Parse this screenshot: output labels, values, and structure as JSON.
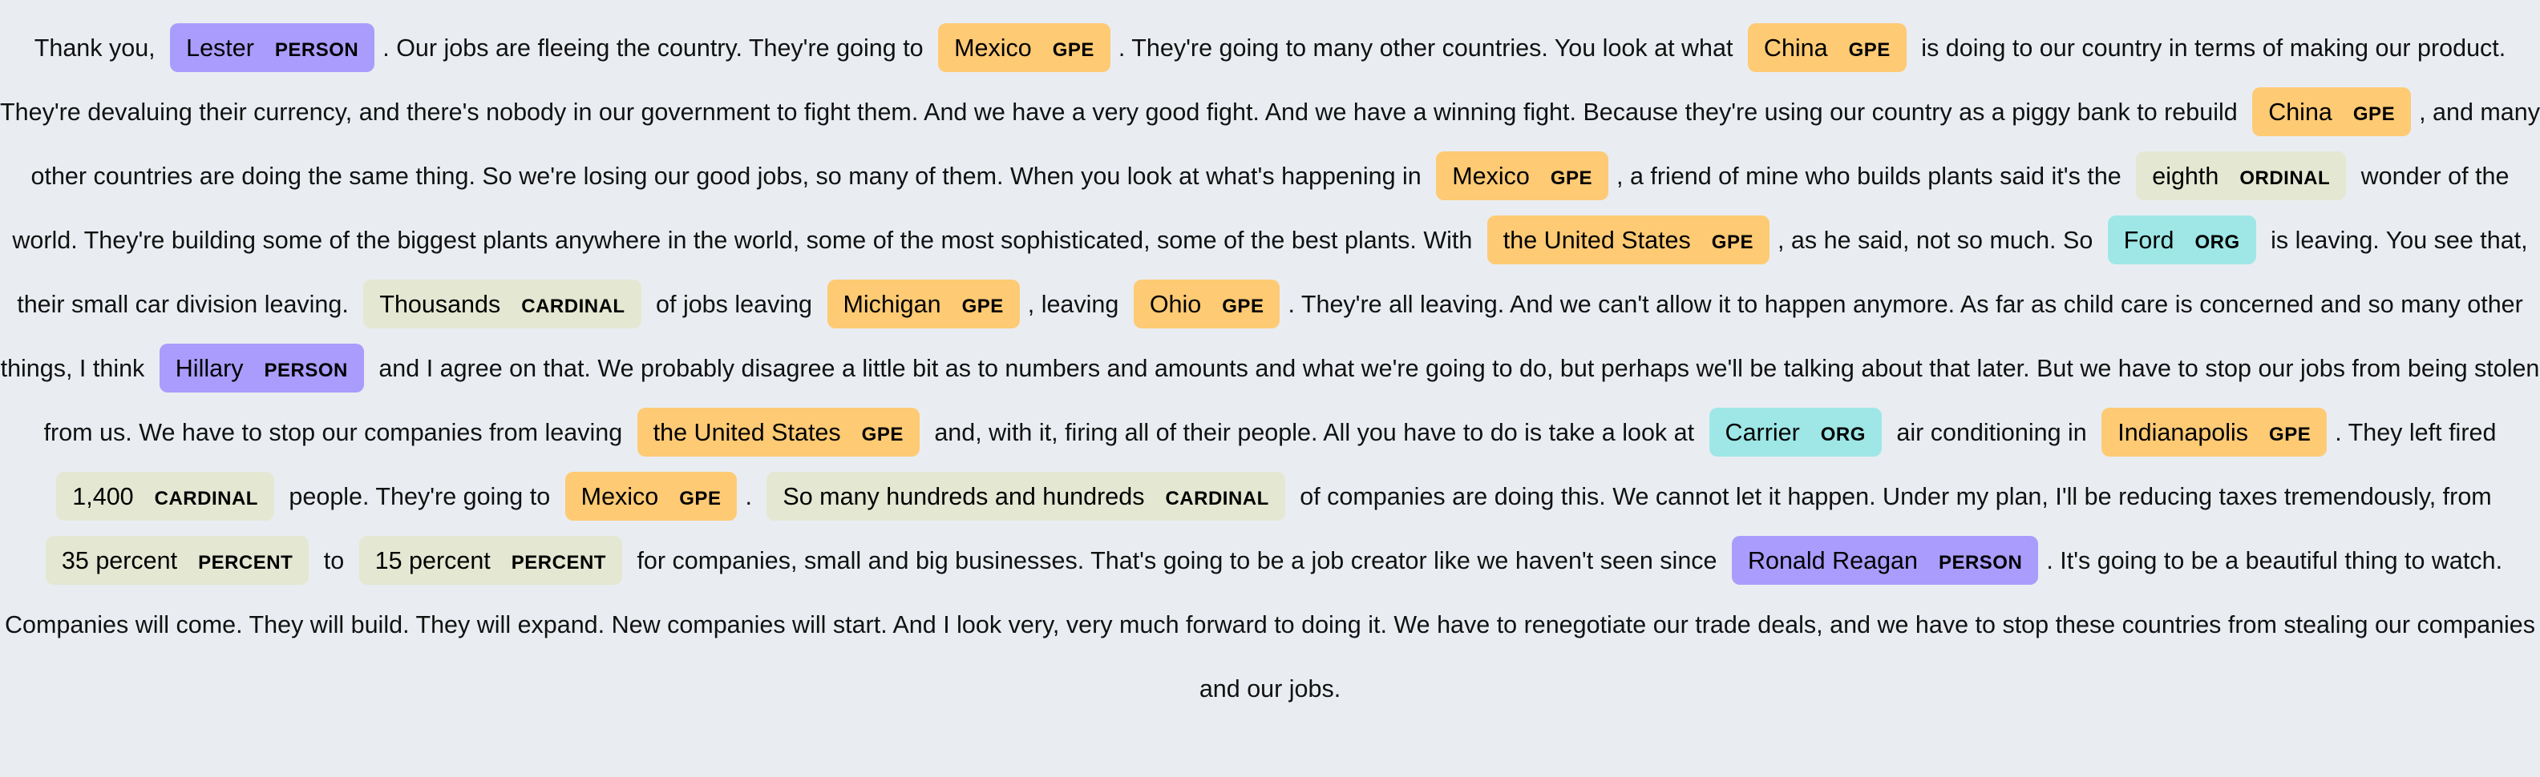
{
  "colors": {
    "PERSON": "#aa9cfc",
    "GPE": "#feca74",
    "ORG": "#9fe7e7",
    "ORDINAL": "#e4e7d2",
    "CARDINAL": "#e4e7d2",
    "PERCENT": "#e4e7d2",
    "background": "#e9edf1"
  },
  "segments": [
    {
      "text": "Thank you, "
    },
    {
      "entity": "Lester",
      "label": "PERSON"
    },
    {
      "text": ". Our jobs are fleeing the country. They're going to "
    },
    {
      "entity": "Mexico",
      "label": "GPE"
    },
    {
      "text": ". They're going to many other countries. You look at what "
    },
    {
      "entity": "China",
      "label": "GPE"
    },
    {
      "text": " is doing to our country in terms of making our product. They're devaluing their currency, and there's nobody in our government to fight them. And we have a very good fight. And we have a winning fight. Because they're using our country as a piggy bank to rebuild "
    },
    {
      "entity": "China",
      "label": "GPE"
    },
    {
      "text": ", and many other countries are doing the same thing. So we're losing our good jobs, so many of them. When you look at what's happening in "
    },
    {
      "entity": "Mexico",
      "label": "GPE"
    },
    {
      "text": ", a friend of mine who builds plants said it's the "
    },
    {
      "entity": "eighth",
      "label": "ORDINAL"
    },
    {
      "text": " wonder of the world. They're building some of the biggest plants anywhere in the world, some of the most sophisticated, some of the best plants. With "
    },
    {
      "entity": "the United States",
      "label": "GPE"
    },
    {
      "text": ", as he said, not so much. So "
    },
    {
      "entity": "Ford",
      "label": "ORG"
    },
    {
      "text": " is leaving. You see that, their small car division leaving. "
    },
    {
      "entity": "Thousands",
      "label": "CARDINAL"
    },
    {
      "text": " of jobs leaving "
    },
    {
      "entity": "Michigan",
      "label": "GPE"
    },
    {
      "text": ", leaving "
    },
    {
      "entity": "Ohio",
      "label": "GPE"
    },
    {
      "text": ". They're all leaving. And we can't allow it to happen anymore. As far as child care is concerned and so many other things, I think "
    },
    {
      "entity": "Hillary",
      "label": "PERSON"
    },
    {
      "text": " and I agree on that. We probably disagree a little bit as to numbers and amounts and what we're going to do, but perhaps we'll be talking about that later. But we have to stop our jobs from being stolen from us. We have to stop our companies from leaving "
    },
    {
      "entity": "the United States",
      "label": "GPE"
    },
    {
      "text": " and, with it, firing all of their people. All you have to do is take a look at "
    },
    {
      "entity": "Carrier",
      "label": "ORG"
    },
    {
      "text": " air conditioning in "
    },
    {
      "entity": "Indianapolis",
      "label": "GPE"
    },
    {
      "text": ". They left fired "
    },
    {
      "entity": "1,400",
      "label": "CARDINAL"
    },
    {
      "text": " people. They're going to "
    },
    {
      "entity": "Mexico",
      "label": "GPE"
    },
    {
      "text": ". "
    },
    {
      "entity": "So many hundreds and hundreds",
      "label": "CARDINAL"
    },
    {
      "text": " of companies are doing this. We cannot let it happen. Under my plan, I'll be reducing taxes tremendously, from "
    },
    {
      "entity": "35 percent",
      "label": "PERCENT"
    },
    {
      "text": " to "
    },
    {
      "entity": "15 percent",
      "label": "PERCENT"
    },
    {
      "text": " for companies, small and big businesses. That's going to be a job creator like we haven't seen since "
    },
    {
      "entity": "Ronald Reagan",
      "label": "PERSON"
    },
    {
      "text": ". It's going to be a beautiful thing to watch. Companies will come. They will build. They will expand. New companies will start. And I look very, very much forward to doing it. We have to renegotiate our trade deals, and we have to stop these countries from stealing our companies and our jobs."
    }
  ]
}
